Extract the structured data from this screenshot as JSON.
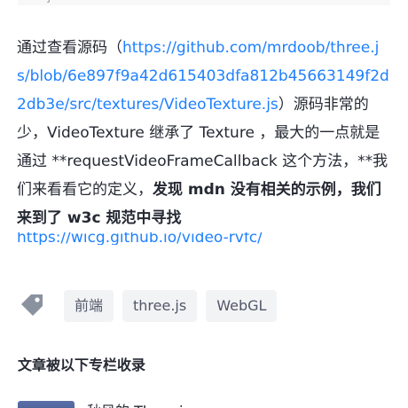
{
  "article": {
    "intro": "通过查看源码（",
    "source_link": "https://github.com/mrdoob/three.js/blob/6e897f9a42d615403dfa812b45663149f2d2db3e/src/textures/VideoTexture.js",
    "after_link": "）源码非常的少，VideoTexture 继承了 Texture ，最大的一点就是通过 **requestVideoFrameCallback 这个方法，**我们来看看它的定义，",
    "bold_text": "发现 mdn 没有相关的示例，我们来到了 w3c 规范中寻找",
    "spec_link": "https://wicg.github.io/video-rvfc/"
  },
  "tags": [
    {
      "label": "前端"
    },
    {
      "label": "three.js"
    },
    {
      "label": "WebGL"
    }
  ],
  "colors": {
    "link": "#1e80ff",
    "tag_bg": "#f2f3f5",
    "tag_text": "#515767"
  },
  "icons": {
    "tag": "tag-icon"
  },
  "columns": {
    "title": "文章被以下专栏收录",
    "items": [
      {
        "name": "秋风的 Three.js"
      }
    ]
  }
}
